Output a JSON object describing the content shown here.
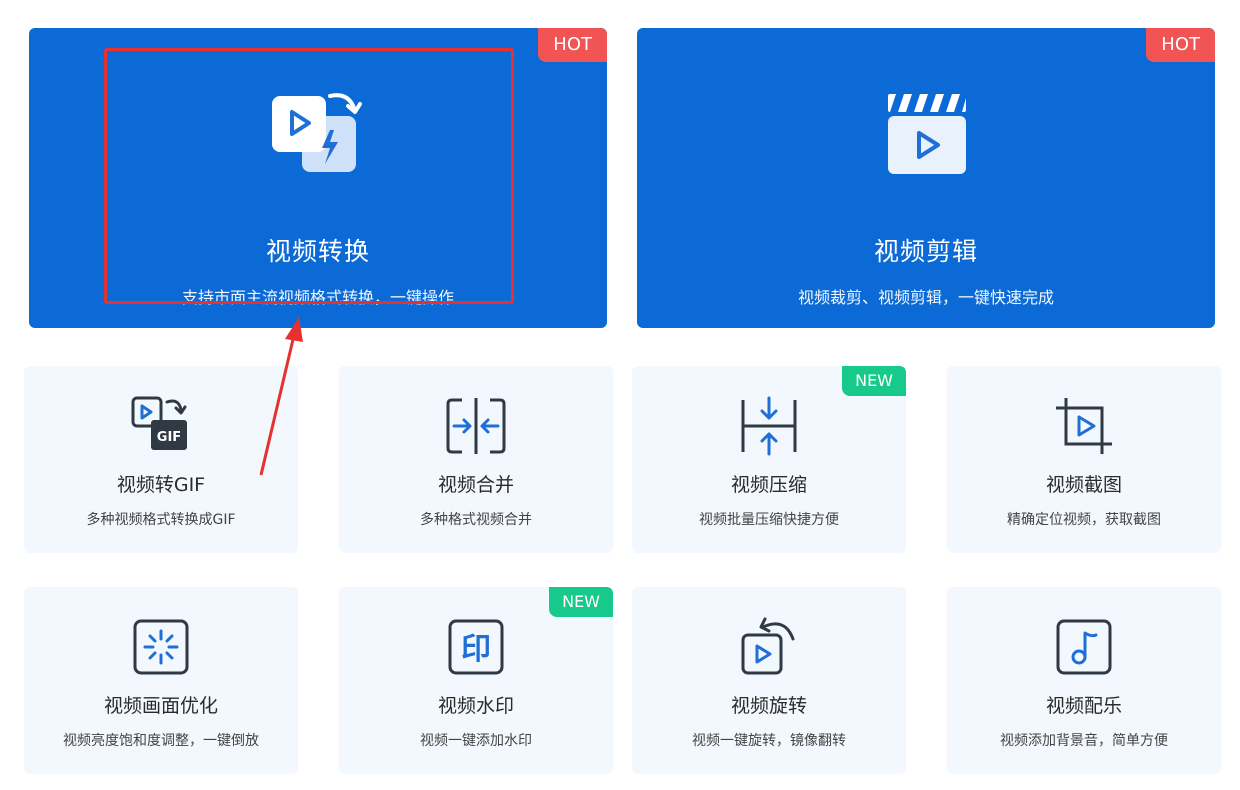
{
  "colors": {
    "primary_blue": "#0b6ad6",
    "card_bg": "#f2f8fd",
    "hot_badge": "#f25353",
    "new_badge": "#17c98a",
    "icon_dark": "#2f3a45",
    "icon_accent": "#1f6fd6",
    "annotation_red": "#e5322f"
  },
  "featured": [
    {
      "title": "视频转换",
      "desc": "支持市面主流视频格式转换，一键操作",
      "badge": "HOT",
      "icon": "video-convert-icon"
    },
    {
      "title": "视频剪辑",
      "desc": "视频裁剪、视频剪辑，一键快速完成",
      "badge": "HOT",
      "icon": "clapperboard-icon"
    }
  ],
  "tools": [
    {
      "title": "视频转GIF",
      "desc": "多种视频格式转换成GIF",
      "badge": "",
      "icon": "video-to-gif-icon"
    },
    {
      "title": "视频合并",
      "desc": "多种格式视频合并",
      "badge": "",
      "icon": "merge-icon"
    },
    {
      "title": "视频压缩",
      "desc": "视频批量压缩快捷方便",
      "badge": "NEW",
      "icon": "compress-icon"
    },
    {
      "title": "视频截图",
      "desc": "精确定位视频，获取截图",
      "badge": "",
      "icon": "crop-icon"
    },
    {
      "title": "视频画面优化",
      "desc": "视频亮度饱和度调整，一键倒放",
      "badge": "",
      "icon": "brightness-icon"
    },
    {
      "title": "视频水印",
      "desc": "视频一键添加水印",
      "badge": "NEW",
      "icon": "watermark-icon"
    },
    {
      "title": "视频旋转",
      "desc": "视频一键旋转，镜像翻转",
      "badge": "",
      "icon": "rotate-icon"
    },
    {
      "title": "视频配乐",
      "desc": "视频添加背景音，简单方便",
      "badge": "",
      "icon": "music-icon"
    }
  ],
  "watermark_glyph": "印",
  "gif_label": "GIF"
}
